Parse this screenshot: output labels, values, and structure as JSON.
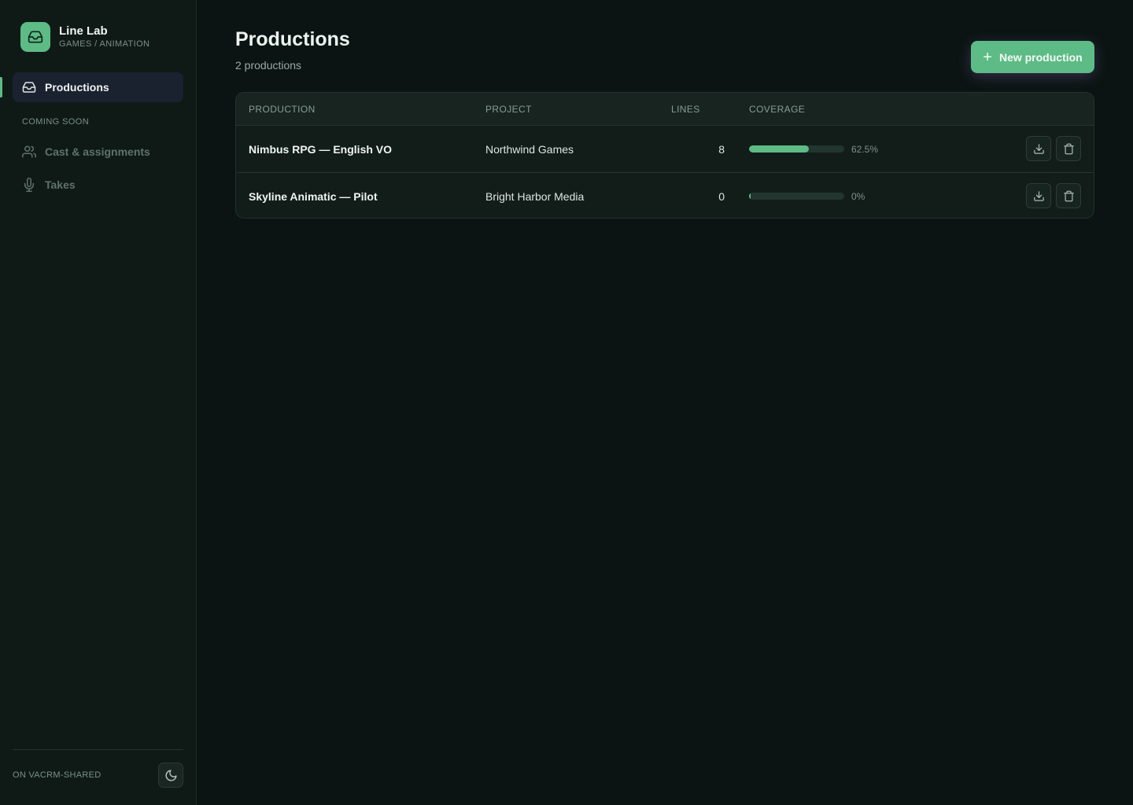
{
  "brand": {
    "name": "Line Lab",
    "subtitle": "GAMES / ANIMATION",
    "accent_color": "#5dbb85",
    "logo_icon": "inbox-icon"
  },
  "sidebar": {
    "active_item": {
      "label": "Productions",
      "icon": "inbox-icon"
    },
    "section_label": "COMING SOON",
    "items": [
      {
        "label": "Cast & assignments",
        "icon": "users-icon"
      },
      {
        "label": "Takes",
        "icon": "microphone-icon"
      }
    ],
    "footer_text": "ON VACRM-SHARED",
    "theme_icon": "moon-icon"
  },
  "header": {
    "title": "Productions",
    "count_text": "2 productions",
    "new_button_label": "New production"
  },
  "table": {
    "columns": {
      "production": "PRODUCTION",
      "project": "PROJECT",
      "lines": "LINES",
      "coverage": "COVERAGE"
    },
    "rows": [
      {
        "name": "Nimbus RPG — English VO",
        "project": "Northwind Games",
        "lines": "8",
        "coverage_text": "62.5%",
        "coverage": 62.5
      },
      {
        "name": "Skyline Animatic — Pilot",
        "project": "Bright Harbor Media",
        "lines": "0",
        "coverage_text": "0%",
        "coverage": 0
      }
    ],
    "row_actions": [
      "download-icon",
      "trash-icon"
    ]
  }
}
